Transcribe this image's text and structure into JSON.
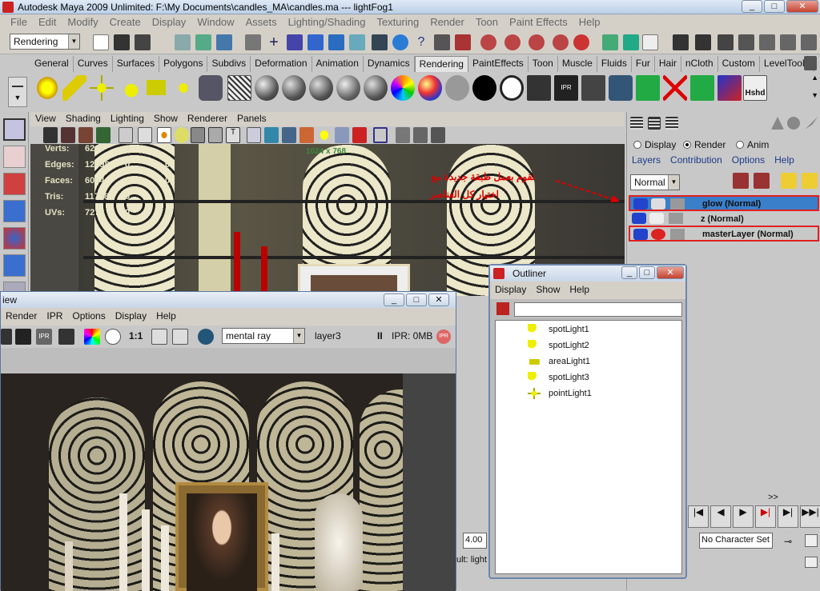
{
  "window": {
    "title": "Autodesk Maya 2009 Unlimited: F:\\My Documents\\candles_MA\\candles.ma  ---  lightFog1"
  },
  "menubar": [
    "File",
    "Edit",
    "Modify",
    "Create",
    "Display",
    "Window",
    "Assets",
    "Lighting/Shading",
    "Texturing",
    "Render",
    "Toon",
    "Paint Effects",
    "Help"
  ],
  "statusline": {
    "mode": "Rendering"
  },
  "shelf_tabs": [
    "General",
    "Curves",
    "Surfaces",
    "Polygons",
    "Subdivs",
    "Deformation",
    "Animation",
    "Dynamics",
    "Rendering",
    "PaintEffects",
    "Toon",
    "Muscle",
    "Fluids",
    "Fur",
    "Hair",
    "nCloth",
    "Custom",
    "LevelTools"
  ],
  "active_shelf_tab": "Rendering",
  "shelf": {
    "last_icon_label": "Hshd"
  },
  "viewport": {
    "menu": [
      "View",
      "Shading",
      "Lighting",
      "Show",
      "Renderer",
      "Panels"
    ],
    "resolution": "1024 x 768",
    "hud": [
      {
        "label": "Verts:",
        "v1": "6205",
        "v2": "0",
        "v3": "0"
      },
      {
        "label": "Edges:",
        "v1": "12098",
        "v2": "0",
        "v3": "0"
      },
      {
        "label": "Faces:",
        "v1": "6004",
        "v2": "0",
        "v3": "0"
      },
      {
        "label": "Tris:",
        "v1": "11748",
        "v2": "0",
        "v3": "0"
      },
      {
        "label": "UVs:",
        "v1": "7270",
        "v2": "0",
        "v3": "0"
      }
    ],
    "annotation_line1": "نقوم بعمل طبقة جديدة مع",
    "annotation_line2": "اختيار كل العناصر"
  },
  "layer_editor": {
    "modes": [
      "Display",
      "Render",
      "Anim"
    ],
    "selected_mode": "Render",
    "menu": [
      "Layers",
      "Contribution",
      "Options",
      "Help"
    ],
    "blend_mode": "Normal",
    "layers": [
      "glow (Normal)",
      "z (Normal)",
      "masterLayer (Normal)"
    ],
    "selected_layer": "glow (Normal)"
  },
  "render_view": {
    "title_fragment": "iew",
    "menu": [
      "Render",
      "IPR",
      "Options",
      "Display",
      "Help"
    ],
    "ratio": "1:1",
    "renderer": "mental ray",
    "layer": "layer3",
    "ipr_status": "IPR: 0MB"
  },
  "outliner": {
    "title": "Outliner",
    "menu": [
      "Display",
      "Show",
      "Help"
    ],
    "items": [
      "spotLight1",
      "spotLight2",
      "areaLight1",
      "spotLight3",
      "pointLight1"
    ]
  },
  "timeline": {
    "end_value": "4.00",
    "character_set": "No Character Set",
    "chevron": ">>",
    "feedback": "ult: light"
  },
  "colors": {
    "accent_red": "#d00000",
    "selection_blue": "#3a7fc9",
    "highlight_border": "#e02020"
  }
}
